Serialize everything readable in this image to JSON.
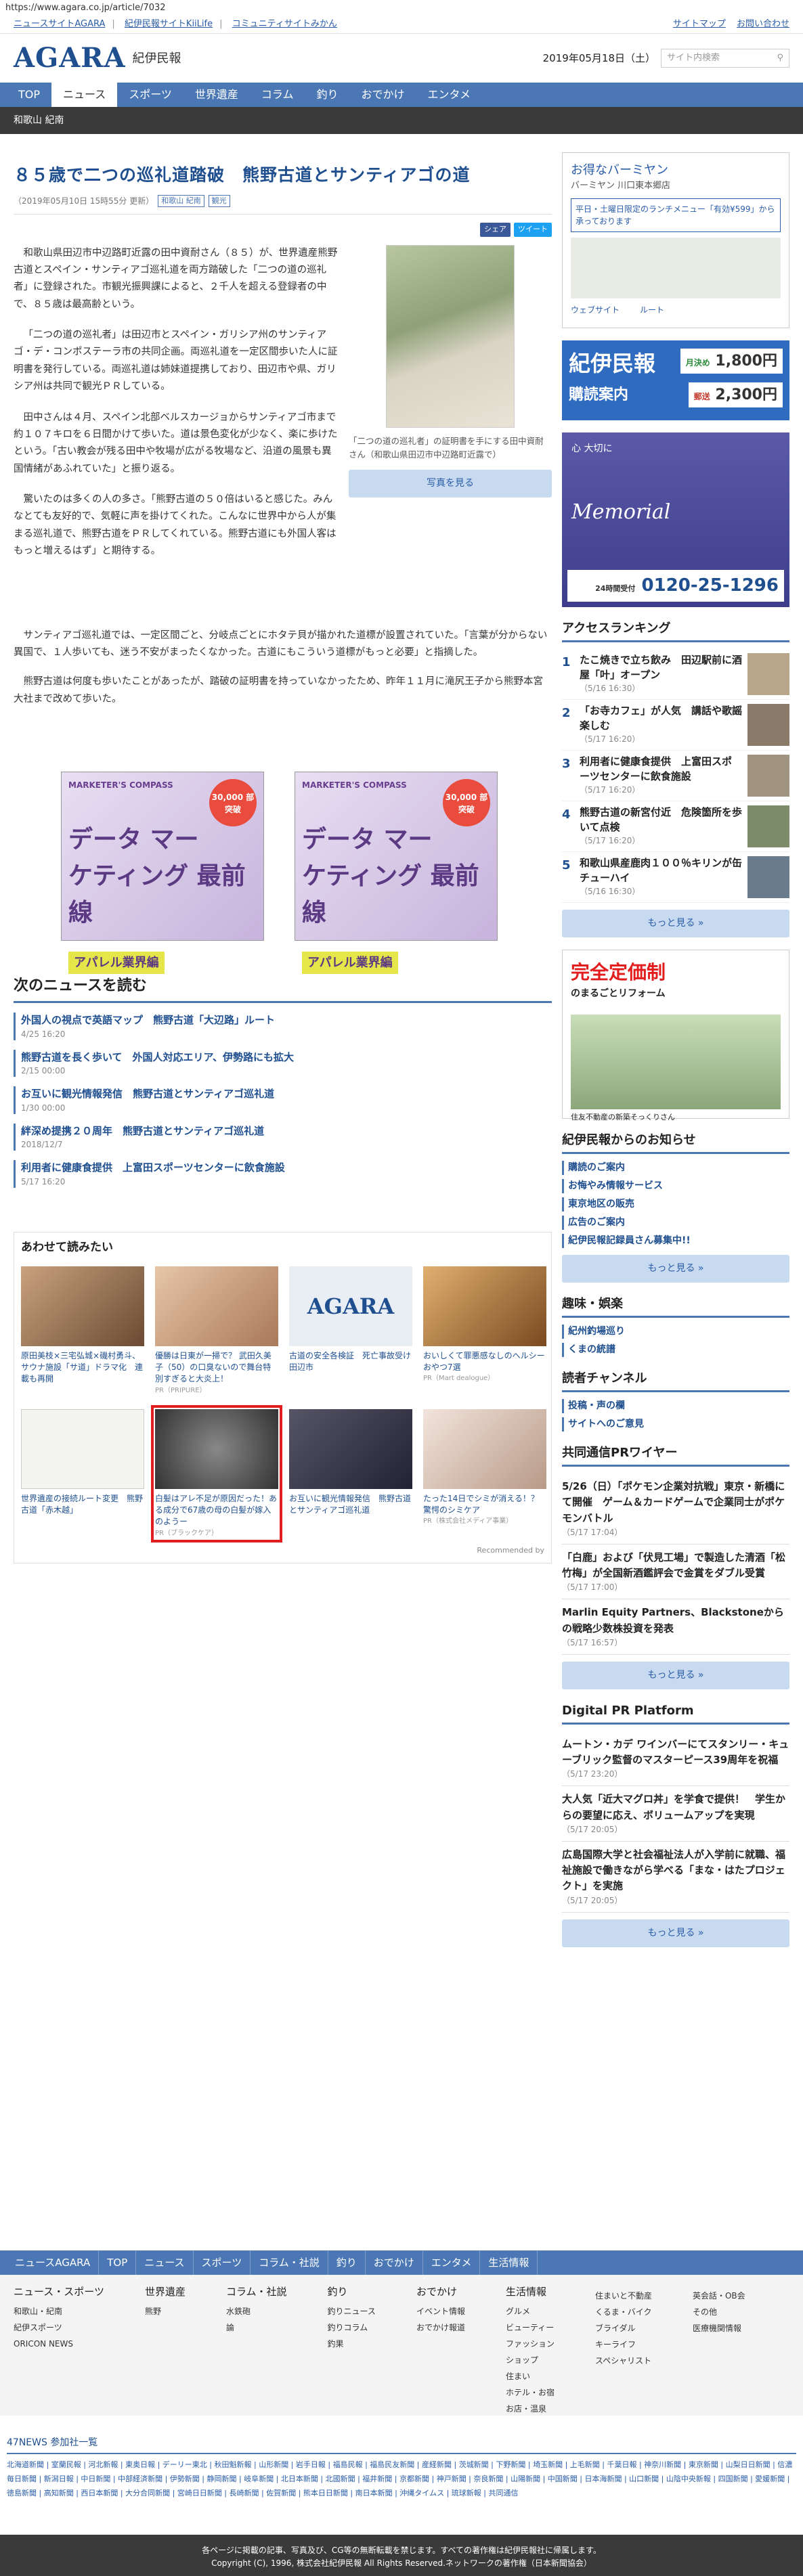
{
  "url": "https://www.agara.co.jp/article/7032",
  "topbar": {
    "links": [
      "ニュースサイトAGARA",
      "紀伊民報サイトKiiLife",
      "コミュニティサイトみかん"
    ],
    "sitemap": "サイトマップ",
    "inquiry": "お問い合わせ"
  },
  "header": {
    "logo_en": "AGARA",
    "logo_ja": "紀伊民報",
    "date": "2019年05月18日（土）",
    "search_placeholder": "サイト内検索"
  },
  "gnav": [
    "TOP",
    "ニュース",
    "スポーツ",
    "世界遺産",
    "コラム",
    "釣り",
    "おでかけ",
    "エンタメ"
  ],
  "subnav": "和歌山 紀南",
  "article": {
    "title": "８５歳で二つの巡礼道踏破　熊野古道とサンティアゴの道",
    "meta": "（2019年05月10日 15時55分 更新）",
    "tags": [
      "和歌山 紀南",
      "観光"
    ],
    "share_fb": "シェア",
    "share_tw": "ツイート",
    "paragraphs": [
      "和歌山県田辺市中辺路町近露の田中資耐さん（８５）が、世界遺産熊野古道とスペイン・サンティアゴ巡礼道を両方踏破した「二つの道の巡礼者」に登録された。市観光振興課によると、２千人を超える登録者の中で、８５歳は最高齢という。",
      "「二つの道の巡礼者」は田辺市とスペイン・ガリシア州のサンティアゴ・デ・コンポステーラ市の共同企画。両巡礼道を一定区間歩いた人に証明書を発行している。両巡礼道は姉妹道提携しており、田辺市や県、ガリシア州は共同で観光ＰＲしている。",
      "田中さんは４月、スペイン北部ベルスカージョからサンティアゴ市まで約１０７キロを６日間かけて歩いた。道は景色変化が少なく、楽に歩けたという。「古い教会が残る田中や牧場が広がる牧場など、沿道の風景も異国情緒があふれていた」と振り返る。",
      "驚いたのは多くの人の多さ。「熊野古道の５０倍はいると感じた。みんなとても友好的で、気軽に声を掛けてくれた。こんなに世界中から人が集まる巡礼道で、熊野古道をＰＲしてくれている。熊野古道にも外国人客はもっと増えるはず」と期待する。"
    ],
    "paragraphs2": [
      "サンティアゴ巡礼道では、一定区間ごと、分岐点ごとにホタテ貝が描かれた道標が設置されていた。「言葉が分からない異国で、１人歩いても、迷う不安がまったくなかった。古道にもこういう道標がもっと必要」と指摘した。",
      "熊野古道は何度も歩いたことがあったが、踏破の証明書を持っていなかったため、昨年１１月に滝尻王子から熊野本宮大社まで改めて歩いた。"
    ],
    "photo_caption": "「二つの道の巡礼者」の証明書を手にする田中資耐さん（和歌山県田辺市中辺路町近露で）",
    "photo_button": "写真を見る"
  },
  "ads": [
    {
      "brand": "MARKETER'S COMPASS",
      "headline": "データ マーケティング 最前線",
      "badge": "30,000 部突破",
      "strip": "アパレル業界編"
    },
    {
      "brand": "MARKETER'S COMPASS",
      "headline": "データ マーケティング 最前線",
      "badge": "30,000 部突破",
      "strip": "アパレル業界編"
    }
  ],
  "next_news": {
    "heading": "次のニュースを読む",
    "items": [
      {
        "title": "外国人の視点で英語マップ　熊野古道「大辺路」ルート",
        "date": "4/25 16:20"
      },
      {
        "title": "熊野古道を長く歩いて　外国人対応エリア、伊勢路にも拡大",
        "date": "2/15 00:00"
      },
      {
        "title": "お互いに観光情報発信　熊野古道とサンティアゴ巡礼道",
        "date": "1/30 00:00"
      },
      {
        "title": "絆深め提携２０周年　熊野古道とサンティアゴ巡礼道",
        "date": "2018/12/7"
      },
      {
        "title": "利用者に健康食提供　上富田スポーツセンターに飲食施設",
        "date": "5/17 16:20"
      }
    ]
  },
  "recommend": {
    "heading": "あわせて読みたい",
    "cards": [
      {
        "title": "原田美枝×三宅弘城×磯村勇斗、サウナ施設「サ道」ドラマ化　連載も再開",
        "src": ""
      },
      {
        "title": "優勝は日東が一掃で？ 武田久美子（50）の口臭ないので舞台特別すぎると大炎上！",
        "src": "PR（PRIPURE）"
      },
      {
        "title": "古道の安全各検証　死亡事故受け田辺市",
        "src": ""
      },
      {
        "title": "おいしくて罪悪感なしのヘルシーおやつ7選",
        "src": "PR（Mart dealogue）"
      },
      {
        "title": "世界遺産の接続ルート変更　熊野古道「赤木越」",
        "src": ""
      },
      {
        "title": "白髪はアレ不足が原因だった！ある成分で67歳の母の白髪が嫁入のようー",
        "src": "PR（ブラックケア）"
      },
      {
        "title": "お互いに観光情報発信　熊野古道とサンティアゴ巡礼道",
        "src": ""
      },
      {
        "title": "たった14日でシミが消える！？驚愕のシミケア",
        "src": "PR（株式会社メディア事業）"
      }
    ],
    "footer": "Recommended by"
  },
  "sidebar": {
    "map": {
      "title": "お得なバーミヤン",
      "sub": "バーミヤン 川口東本郷店",
      "promo": "平日・土曜日限定のランチメニュー「有効¥599」から承っております",
      "dir1": "ウェブサイト",
      "dir2": "ルート"
    },
    "kii": {
      "name": "紀伊民報",
      "label": "購読案内",
      "price1": "1,800円",
      "price1_tag": "月決め",
      "price2": "2,300円",
      "price2_tag": "郵送"
    },
    "mem": {
      "head": "心 大切に",
      "brand": "Memorial",
      "tel": "0120-25-1296",
      "tel_label": "24時間受付"
    },
    "ranking": {
      "heading": "アクセスランキング",
      "items": [
        {
          "n": "1",
          "title": "たこ焼きで立ち飲み　田辺駅前に酒屋「叶」オープン",
          "date": "（5/16 16:30）"
        },
        {
          "n": "2",
          "title": "「お寺カフェ」が人気　講話や歌謡楽しむ",
          "date": "（5/17 16:20）"
        },
        {
          "n": "3",
          "title": "利用者に健康食提供　上富田スポーツセンターに飲食施設",
          "date": "（5/17 16:20）"
        },
        {
          "n": "4",
          "title": "熊野古道の新宮付近　危険箇所を歩いて点検",
          "date": "（5/17 16:20）"
        },
        {
          "n": "5",
          "title": "和歌山県産鹿肉１００％キリンが缶チューハイ",
          "date": "（5/16 16:30）"
        }
      ],
      "more": "もっと見る »"
    },
    "reform": {
      "title": "完全定価制",
      "sub": "のまるごとリフォーム",
      "foot": "住友不動産の新築そっくりさん"
    },
    "notice": {
      "heading": "紀伊民報からのお知らせ",
      "items": [
        "購読のご案内",
        "お悔やみ情報サービス",
        "東京地区の販売",
        "広告のご案内",
        "紀伊民報記録員さん募集中!!"
      ],
      "more": "もっと見る »"
    },
    "hobby": {
      "heading": "趣味・娯楽",
      "items": [
        "紀州釣場巡り",
        "くまの統譜"
      ]
    },
    "reader": {
      "heading": "読者チャンネル",
      "items": [
        "投稿・声の欄",
        "サイトへのご意見"
      ]
    },
    "pr": {
      "heading": "共同通信PRワイヤー",
      "items": [
        {
          "t": "5/26（日）「ポケモン企業対抗戦」東京・新橋にて開催　ゲーム＆カードゲームで企業同士がポケモンバトル",
          "d": "（5/17 17:04）"
        },
        {
          "t": "「白鹿」および「伏見工場」で製造した清酒「松竹梅」が全国新酒鑑評会で金賞をダブル受賞",
          "d": "（5/17 17:00）"
        },
        {
          "t": "Marlin Equity Partners、Blackstoneからの戦略少数株投資を発表",
          "d": "（5/17 16:57）"
        }
      ],
      "more": "もっと見る »"
    },
    "dpr": {
      "heading": "Digital PR Platform",
      "items": [
        {
          "t": "ムートン・カデ ワインバーにてスタンリー・キューブリック監督のマスターピース39周年を祝福",
          "d": "（5/17 23:20）"
        },
        {
          "t": "大人気「近大マグロ丼」を学食で提供！　学生からの要望に応え、ボリュームアップを実現",
          "d": "（5/17 20:05）"
        },
        {
          "t": "広島国際大学と社会福祉法人が入学前に就職、福祉施設で働きながら学べる「まな・はたプロジェクト」を実施",
          "d": "（5/17 20:05）"
        }
      ],
      "more": "もっと見る »"
    }
  },
  "footer": {
    "nav": [
      "ニュースAGARA",
      "TOP",
      "ニュース",
      "スポーツ",
      "コラム・社説",
      "釣り",
      "おでかけ",
      "エンタメ",
      "生活情報"
    ],
    "cols": [
      {
        "h": "ニュース・スポーツ",
        "l": [
          "和歌山・紀南",
          "紀伊スポーツ",
          "ORICON NEWS"
        ]
      },
      {
        "h": "世界遺産",
        "l": [
          "熊野"
        ]
      },
      {
        "h": "コラム・社説",
        "l": [
          "水鉄砲",
          "論"
        ]
      },
      {
        "h": "釣り",
        "l": [
          "釣りニュース",
          "釣りコラム",
          "釣果"
        ]
      },
      {
        "h": "おでかけ",
        "l": [
          "イベント情報",
          "おでかけ報道"
        ]
      },
      {
        "h": "生活情報",
        "l": [
          "グルメ",
          "ビューティー",
          "ファッション",
          "ショップ",
          "住まい",
          "ホテル・お宿",
          "お店・温泉"
        ]
      },
      {
        "h": "",
        "l": [
          "住まいと不動産",
          "くるま・バイク",
          "ブライダル",
          "キーライフ",
          "スペシャリスト"
        ]
      },
      {
        "h": "",
        "l": [
          "英会話・OB会",
          "その他",
          "医療機関情報"
        ]
      }
    ],
    "n47": "47NEWS 参加社一覧",
    "papers": "北海道新聞 | 室蘭民報 | 河北新報 | 東奥日報 | デーリー東北 | 秋田魁新報 | 山形新聞 | 岩手日報 | 福島民報 | 福島民友新聞 | 産経新聞 | 茨城新聞 | 下野新聞 | 埼玉新聞 | 上毛新聞 | 千葉日報 | 神奈川新聞 | 東京新聞 | 山梨日日新聞 | 信濃毎日新聞 | 新潟日報 | 中日新聞 | 中部経済新聞 | 伊勢新聞 | 静岡新聞 | 岐阜新聞 | 北日本新聞 | 北國新聞 | 福井新聞 | 京都新聞 | 神戸新聞 | 奈良新聞 | 山陽新聞 | 中国新聞 | 日本海新聞 | 山口新聞 | 山陰中央新報 | 四国新聞 | 愛媛新聞 | 徳島新聞 | 高知新聞 | 西日本新聞 | 大分合同新聞 | 宮崎日日新聞 | 長崎新聞 | 佐賀新聞 | 熊本日日新聞 | 南日本新聞 | 沖縄タイムス | 琉球新報 | 共同通信",
    "copy1": "各ページに掲載の記事、写真及び、CG等の無断転載を禁じます。すべての著作権は紀伊民報社に帰属します。",
    "copy2": "Copyright (C), 1996, 株式会社紀伊民報 All Rights Reserved.ネットワークの著作権（日本新聞協会）"
  },
  "colors": {
    "brand": "#1f4f8f",
    "nav": "#4b77b5",
    "subnav": "#3a3a3a",
    "highlight": "#e21d1d"
  }
}
